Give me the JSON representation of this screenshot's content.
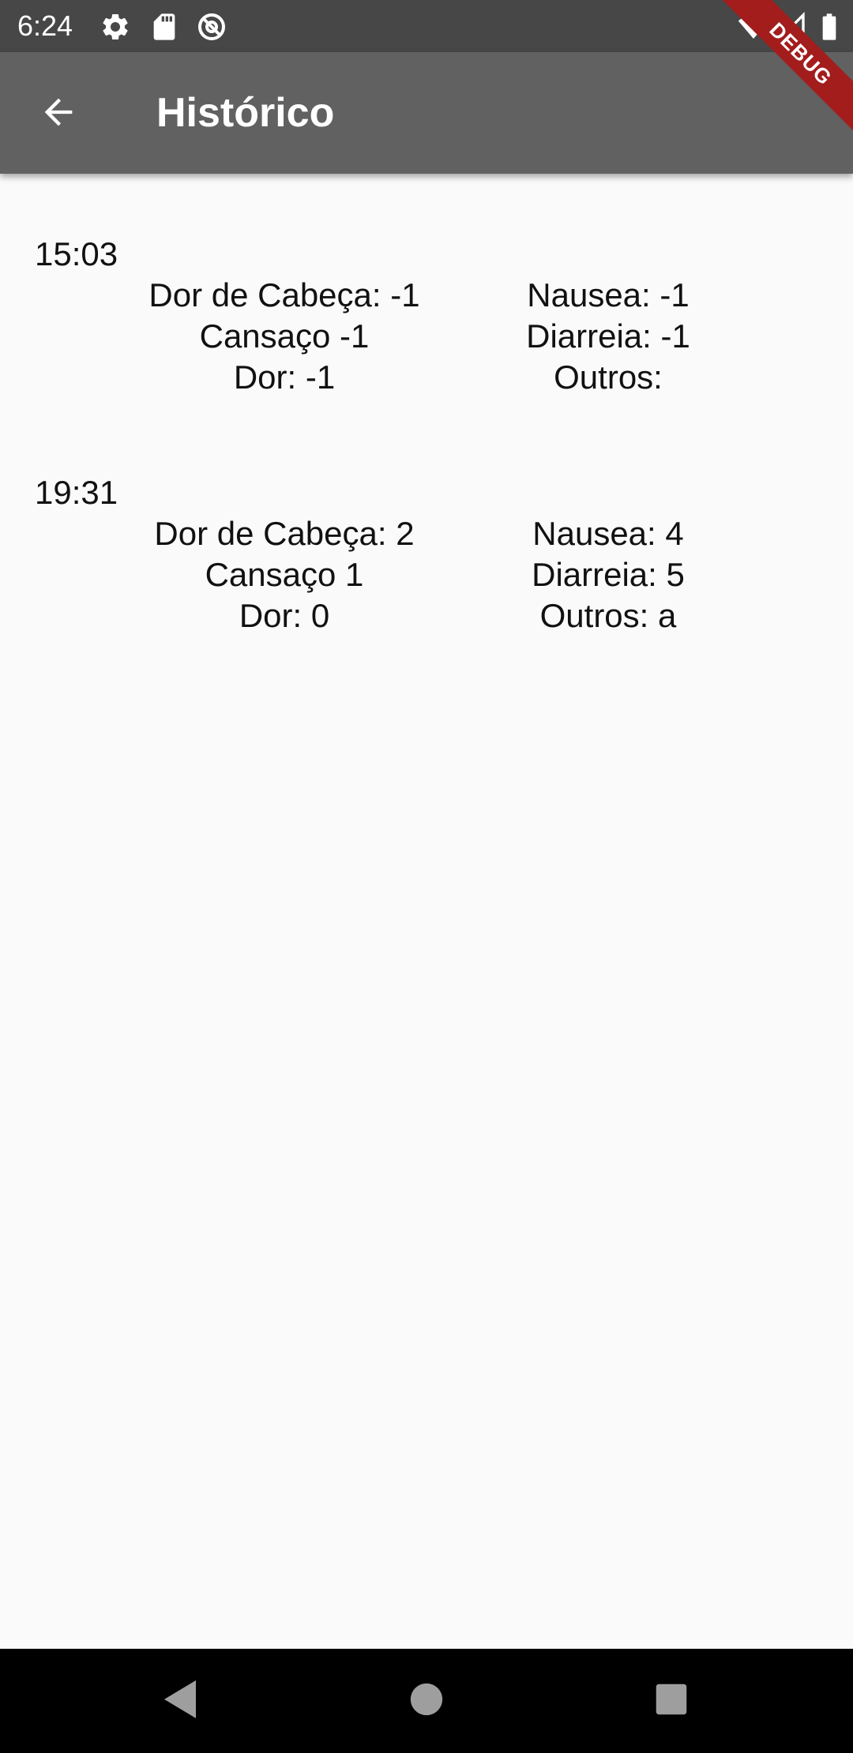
{
  "status_bar": {
    "time": "6:24",
    "icons": [
      "gear-icon",
      "sd-card-icon",
      "at-sign-icon",
      "wifi-icon",
      "signal-icon",
      "battery-icon"
    ]
  },
  "app_bar": {
    "title": "Histórico",
    "back_icon": "arrow-back-icon",
    "background_color": "#616161"
  },
  "debug_ribbon": {
    "label": "DEBUG",
    "color": "#a31d1d"
  },
  "entries": [
    {
      "time": "15:03",
      "dor_de_cabeca": "Dor de Cabeça: -1",
      "nausea": "Nausea: -1",
      "cansaco": "Cansaço -1",
      "diarreia": "Diarreia: -1",
      "dor": "Dor: -1",
      "outros": "Outros: "
    },
    {
      "time": "19:31",
      "dor_de_cabeca": "Dor de Cabeça: 2",
      "nausea": "Nausea: 4",
      "cansaco": "Cansaço 1",
      "diarreia": "Diarreia: 5",
      "dor": "Dor: 0",
      "outros": "Outros: a"
    }
  ],
  "nav_bar": {
    "buttons": [
      "back-triangle-icon",
      "home-circle-icon",
      "recents-square-icon"
    ]
  }
}
